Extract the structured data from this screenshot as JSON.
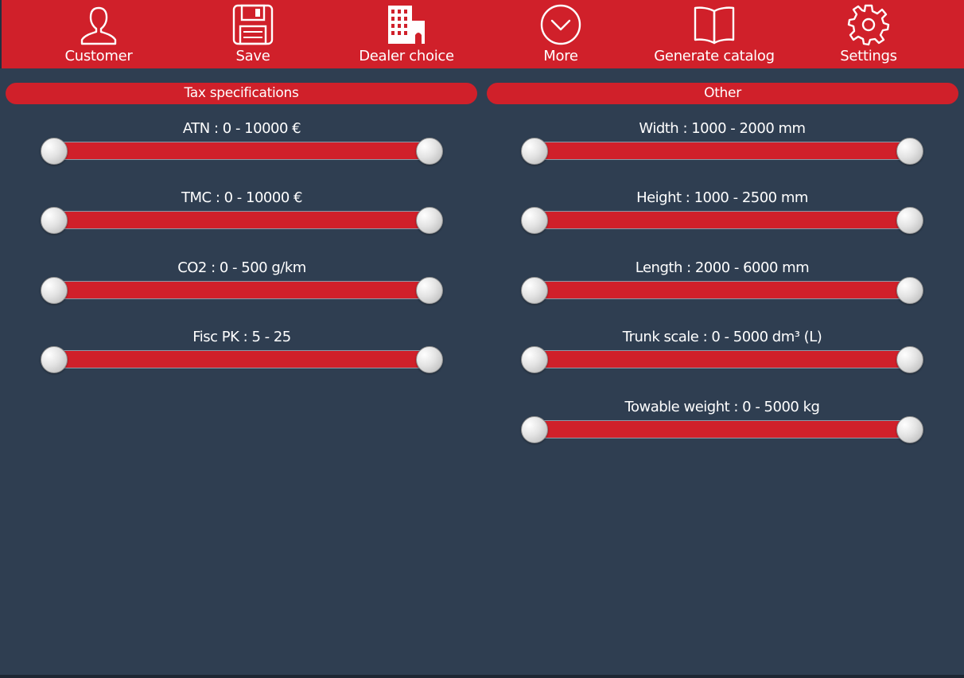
{
  "toolbar": {
    "items": [
      {
        "label": "Customer",
        "icon": "user-icon"
      },
      {
        "label": "Save",
        "icon": "floppy-disk-icon"
      },
      {
        "label": "Dealer choice",
        "icon": "building-icon"
      },
      {
        "label": "More",
        "icon": "chevron-down-circle-icon"
      },
      {
        "label": "Generate catalog",
        "icon": "open-book-icon"
      },
      {
        "label": "Settings",
        "icon": "gear-icon"
      }
    ]
  },
  "tax": {
    "title": "Tax specifications",
    "sliders": [
      {
        "label": "ATN : 0 - 10000 €",
        "min_value": 0,
        "max_value": 10000
      },
      {
        "label": "TMC : 0 - 10000 €",
        "min_value": 0,
        "max_value": 10000
      },
      {
        "label": "CO2 : 0 - 500 g/km",
        "min_value": 0,
        "max_value": 500
      },
      {
        "label": "Fisc PK : 5 - 25",
        "min_value": 5,
        "max_value": 25
      }
    ]
  },
  "other": {
    "title": "Other",
    "sliders": [
      {
        "label": "Width : 1000 - 2000 mm",
        "min_value": 1000,
        "max_value": 2000
      },
      {
        "label": "Height : 1000 - 2500 mm",
        "min_value": 1000,
        "max_value": 2500
      },
      {
        "label": "Length : 2000 - 6000 mm",
        "min_value": 2000,
        "max_value": 6000
      },
      {
        "label": "Trunk scale : 0 - 5000 dm³ (L)",
        "min_value": 0,
        "max_value": 5000
      },
      {
        "label": "Towable weight : 0 - 5000 kg",
        "min_value": 0,
        "max_value": 5000
      }
    ]
  },
  "colors": {
    "accent": "#d0202a",
    "background": "#2f3e51",
    "text": "#ffffff"
  }
}
